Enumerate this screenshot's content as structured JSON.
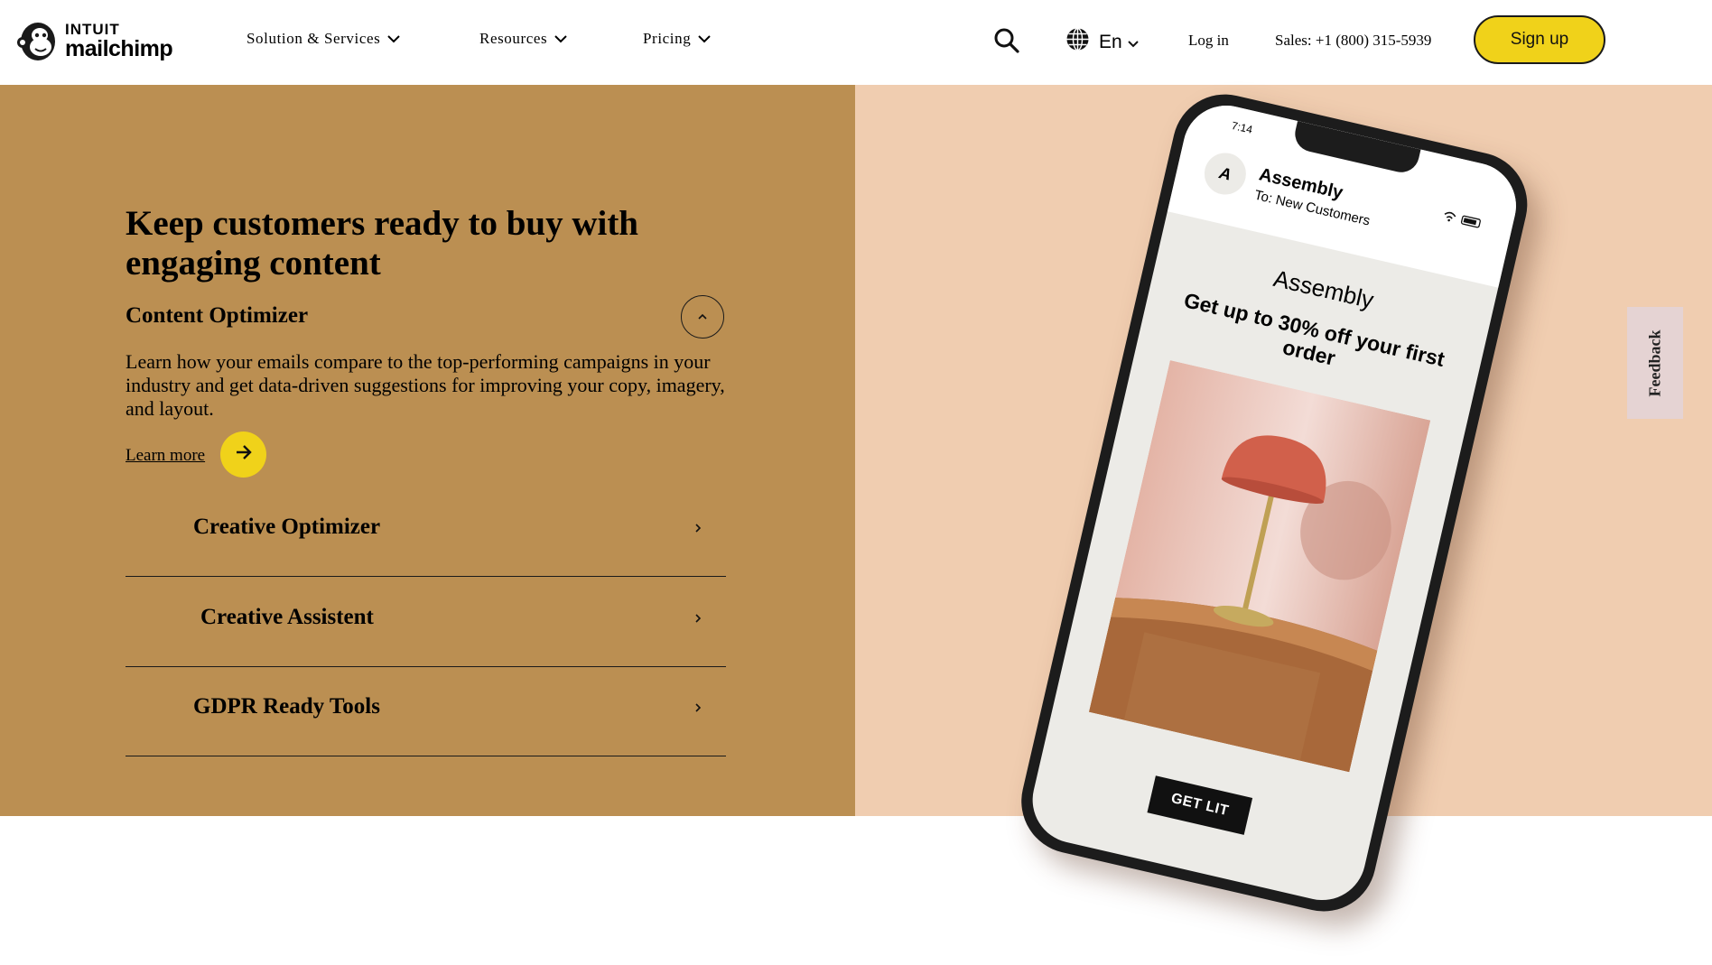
{
  "header": {
    "logo_top": "INTUIT",
    "logo_bottom": "mailchimp",
    "nav": [
      {
        "label": "Solution & Services"
      },
      {
        "label": "Resources"
      },
      {
        "label": "Pricing"
      }
    ],
    "language": "En",
    "login": "Log in",
    "sales": "Sales: +1 (800) 315-5939",
    "signup": "Sign up"
  },
  "main": {
    "headline": "Keep customers ready to buy with engaging content",
    "active_feature": {
      "title": "Content Optimizer",
      "description": "Learn how your emails compare to the top-performing campaigns in your industry and get data-driven suggestions for improving your copy, imagery, and layout.",
      "link": "Learn more"
    },
    "accordion": [
      {
        "label": "Creative Optimizer"
      },
      {
        "label": "Creative Assistent"
      },
      {
        "label": "GDPR Ready Tools"
      }
    ]
  },
  "phone": {
    "time": "7:14",
    "avatar_letter": "A",
    "sender": "Assembly",
    "recipient": "To: New Customers",
    "brand": "Assembly",
    "offer": "Get up to 30% off your first order",
    "cta": "GET LIT"
  },
  "feedback": "Feedback",
  "colors": {
    "accent_yellow": "#f0d21a",
    "left_panel": "#bb8f52",
    "right_panel": "#f0cdb0"
  }
}
